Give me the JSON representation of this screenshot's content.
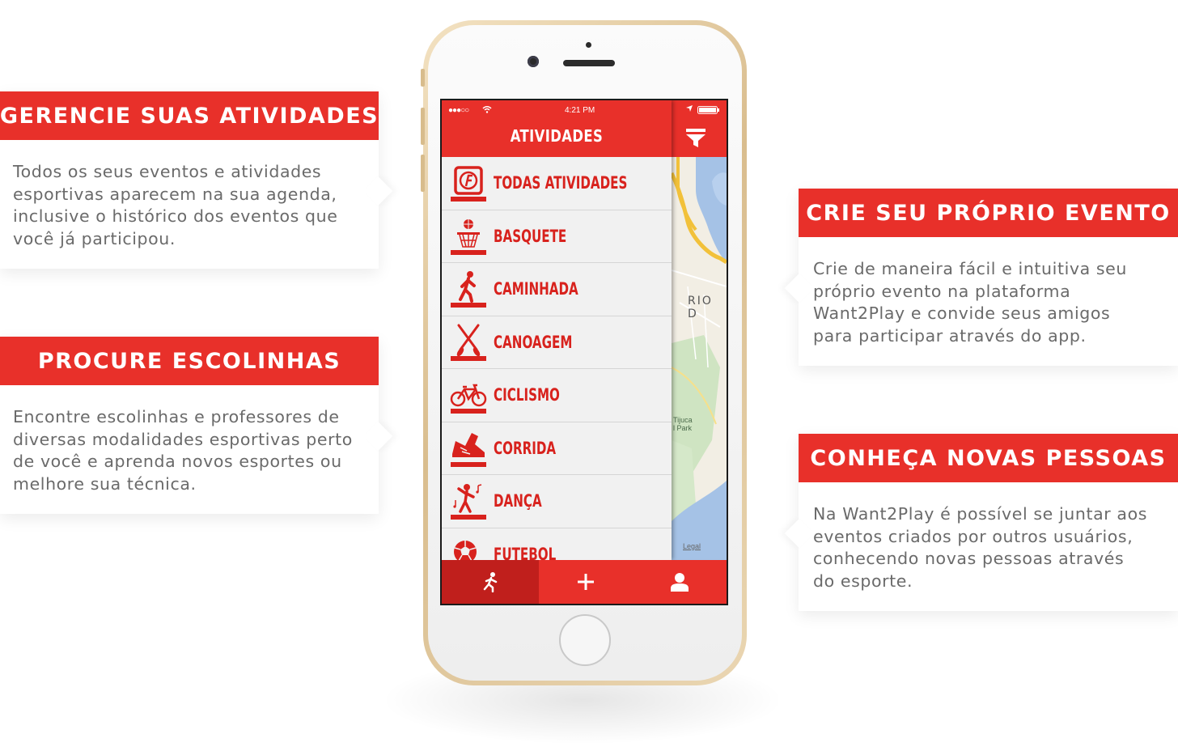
{
  "cards": {
    "gerencie": {
      "title": "GERENCIE SUAS ATIVIDADES",
      "lines": [
        "Todos os seus eventos e atividades",
        "esportivas aparecem na sua agenda,",
        "inclusive o histórico dos eventos que",
        "você já participou."
      ]
    },
    "procure": {
      "title": "PROCURE ESCOLINHAS",
      "lines": [
        "Encontre escolinhas e professores de",
        "diversas modalidades esportivas perto",
        "de você e aprenda novos esportes ou",
        "melhore sua técnica."
      ]
    },
    "crie": {
      "title": "CRIE SEU PRÓPRIO EVENTO",
      "lines": [
        "Crie de maneira fácil e intuitiva seu",
        "próprio evento na plataforma",
        "Want2Play e convide seus amigos",
        "para participar através do app."
      ]
    },
    "conheca": {
      "title": "CONHEÇA NOVAS PESSOAS",
      "lines": [
        "Na Want2Play é possível se juntar aos",
        "eventos criados por outros usuários,",
        "conhecendo novas pessoas através",
        "do esporte."
      ]
    }
  },
  "app": {
    "status_signal": "●●●○○",
    "status_time": "4:21 PM",
    "title": "ATIVIDADES",
    "menu": [
      {
        "label": "TODAS ATIVIDADES",
        "icon": "all-activities-icon"
      },
      {
        "label": "BASQUETE",
        "icon": "basketball-icon"
      },
      {
        "label": "CAMINHADA",
        "icon": "walking-icon"
      },
      {
        "label": "CANOAGEM",
        "icon": "canoe-paddles-icon"
      },
      {
        "label": "CICLISMO",
        "icon": "bicycle-icon"
      },
      {
        "label": "CORRIDA",
        "icon": "running-shoe-icon"
      },
      {
        "label": "DANÇA",
        "icon": "dance-icon"
      },
      {
        "label": "FUTEBOL",
        "icon": "soccer-ball-icon"
      }
    ],
    "map": {
      "city_label": "RIO D",
      "park_label_1": "Tijuca",
      "park_label_2": "l Park",
      "legal": "Legal"
    },
    "tabs": [
      "activities-tab-icon",
      "add-event-icon",
      "profile-icon"
    ]
  },
  "colors": {
    "brand_red": "#e8302a",
    "dark_red": "#c01f1c",
    "text_red": "#d8221d",
    "body_text": "#6a6a6a"
  }
}
